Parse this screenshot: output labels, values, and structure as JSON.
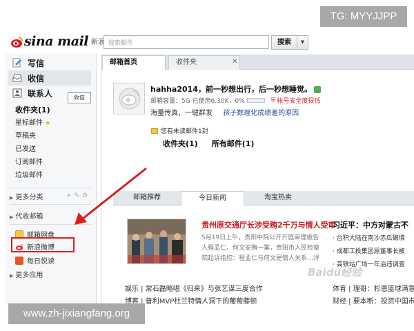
{
  "overlays": {
    "tg": "TG: MYYJJPP",
    "site": "www.zh-jixiangfang.org",
    "watermark": "Baidu经验"
  },
  "header": {
    "logo": "sina mail",
    "logo_sub": "新浪邮箱",
    "search_placeholder": "搜索邮件",
    "search_button": "搜索"
  },
  "sidebar": {
    "write": "写信",
    "receive": "收信",
    "contacts": "联系人",
    "tooltip": "收信",
    "folders": [
      "收件夹(1)",
      "星标邮件",
      "草稿夹",
      "已发送",
      "订阅邮件",
      "垃圾邮件"
    ],
    "more_categories": "更多分类",
    "proxy_mailbox": "代收邮箱",
    "apps": [
      "邮箱网盘",
      "新浪微博",
      "每日悦读"
    ],
    "more_apps": "更多应用"
  },
  "tabs": {
    "home": "邮箱首页",
    "inbox": "收件夹"
  },
  "profile": {
    "greeting": "hahha2014，前一秒想出行，后一秒想睡觉。",
    "quota_label": "邮箱容量：5G 已使用6.30K，0%",
    "safety": "帐号安全度很低",
    "slogan": "海量传真，一键群发",
    "tip_link": "孩子数理化成绩差的原因",
    "unread_notice": "您有未读邮件1封",
    "unread_links": [
      "收件夹(1)",
      "所有邮件(1)"
    ]
  },
  "news": {
    "tabs": [
      "邮箱推荐",
      "今日新闻",
      "淘宝热卖"
    ],
    "headline": "贵州原交通厅长涉受贿2千万与情人受审",
    "meta": [
      "5月19日上午，贵阳中院公开开庭审理被告",
      "人程孟仁、何文安贿一案，贵阳市人民检察",
      "院起诉指控：程孟仁与何文是情人关系…详"
    ],
    "headline2": "习近平：中方对蒙古不",
    "bullets": [
      "台积大陆在南沙赤瓜礁填",
      "成都工投集团原董事长被",
      "高铁站广场一年治违调查"
    ],
    "bottom_left": "娱乐 | 常石磊略唱《归来》与张艺谋三度合作",
    "bottom_left2": "博客 | 普利MVP杜兰特情人洞下的葡萄藤顿",
    "bottom_right": "体育 | 理哥：杉恩篮球满意女",
    "bottom_right2": "财经 | 要本断：投资中国市"
  }
}
